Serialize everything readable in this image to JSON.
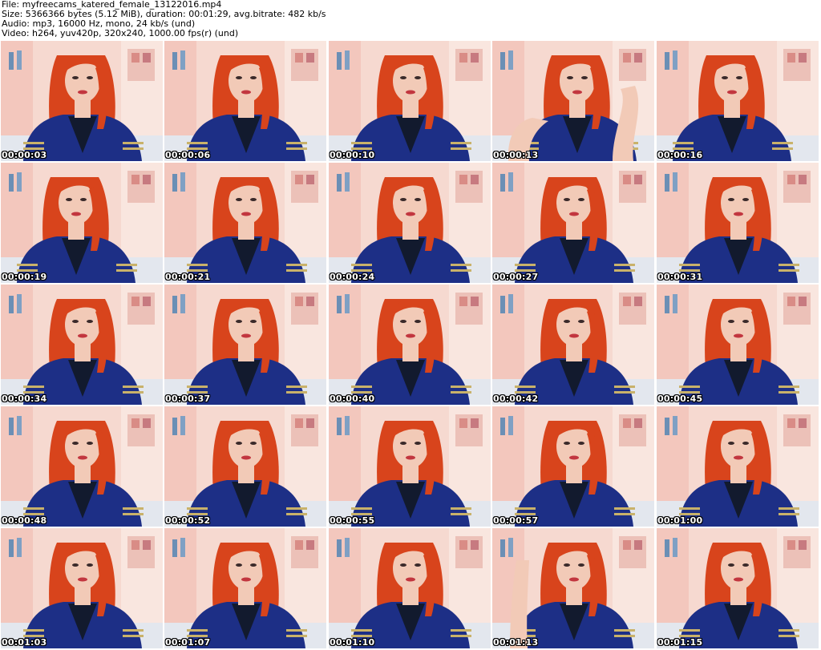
{
  "header": {
    "file_line": "File: myfreecams_katered_female_13122016.mp4",
    "size_line": "Size: 5366366 bytes (5.12 MiB), duration: 00:01:29, avg.bitrate: 482 kb/s",
    "audio_line": "Audio: mp3, 16000 Hz, mono, 24 kb/s (und)",
    "video_line": "Video: h264, yuv420p, 320x240, 1000.00 fps(r) (und)"
  },
  "frames": [
    {
      "time": "00:00:03",
      "pose": "front"
    },
    {
      "time": "00:00:06",
      "pose": "front"
    },
    {
      "time": "00:00:10",
      "pose": "front"
    },
    {
      "time": "00:00:13",
      "pose": "arm-raised"
    },
    {
      "time": "00:00:16",
      "pose": "tilt"
    },
    {
      "time": "00:00:19",
      "pose": "tilt"
    },
    {
      "time": "00:00:21",
      "pose": "front"
    },
    {
      "time": "00:00:24",
      "pose": "front"
    },
    {
      "time": "00:00:27",
      "pose": "front"
    },
    {
      "time": "00:00:31",
      "pose": "front"
    },
    {
      "time": "00:00:34",
      "pose": "front"
    },
    {
      "time": "00:00:37",
      "pose": "front"
    },
    {
      "time": "00:00:40",
      "pose": "front"
    },
    {
      "time": "00:00:42",
      "pose": "front"
    },
    {
      "time": "00:00:45",
      "pose": "front"
    },
    {
      "time": "00:00:48",
      "pose": "front"
    },
    {
      "time": "00:00:52",
      "pose": "front"
    },
    {
      "time": "00:00:55",
      "pose": "front"
    },
    {
      "time": "00:00:57",
      "pose": "front"
    },
    {
      "time": "00:01:00",
      "pose": "front"
    },
    {
      "time": "00:01:03",
      "pose": "front"
    },
    {
      "time": "00:01:07",
      "pose": "front"
    },
    {
      "time": "00:01:10",
      "pose": "front"
    },
    {
      "time": "00:01:13",
      "pose": "hand-hair"
    },
    {
      "time": "00:01:15",
      "pose": "front"
    }
  ],
  "colors": {
    "background": "#ffffff",
    "wall": "#f6d9d0",
    "curtain": "#f3c7bd",
    "hair": "#d8441c",
    "jacket": "#1d2f86",
    "stripe": "#c9b26a",
    "skin": "#f2cab7",
    "shirt": "#121a2e",
    "timestamp_fill": "#ffffff",
    "timestamp_outline": "#000000"
  }
}
